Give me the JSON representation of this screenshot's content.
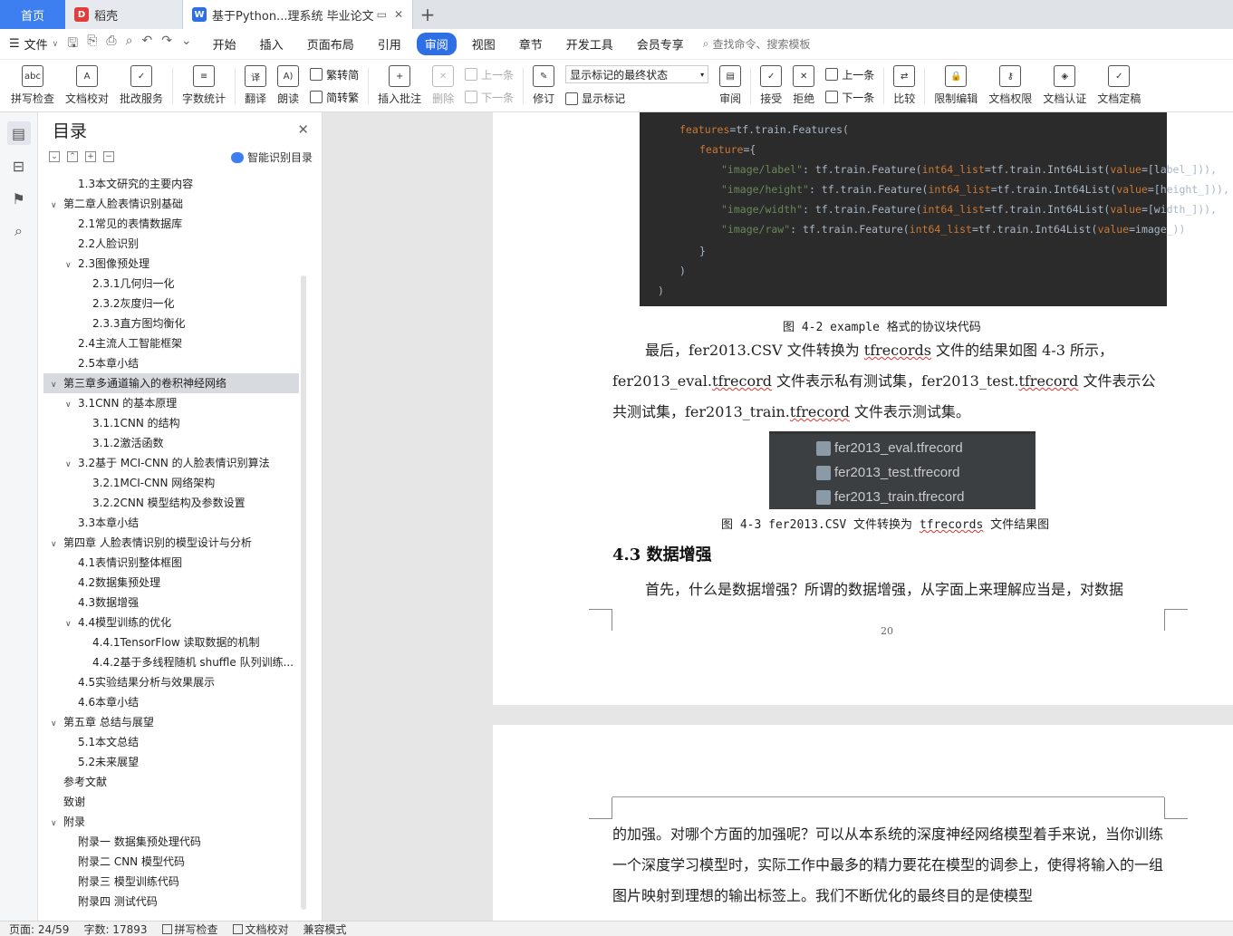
{
  "tabs": {
    "home": "首页",
    "items": [
      {
        "label": "稻壳",
        "state": "inactive",
        "icon": "daoke-logo-icon"
      },
      {
        "label": "基于Python...理系统 毕业论文",
        "state": "active",
        "icon": "wps-writer-logo-icon"
      }
    ]
  },
  "menu": {
    "file": "文件",
    "items": [
      "开始",
      "插入",
      "页面布局",
      "引用",
      "审阅",
      "视图",
      "章节",
      "开发工具",
      "会员专享"
    ],
    "active": "审阅",
    "search_placeholder": "查找命令、搜索模板"
  },
  "ribbon": {
    "spell_check": "拼写检查",
    "doc_proof": "文档校对",
    "annotate_service": "批改服务",
    "word_count": "字数统计",
    "translate": "翻译",
    "read_aloud": "朗读",
    "to_traditional": "繁转简",
    "to_simplified": "简转繁",
    "insert_comment": "插入批注",
    "delete": "删除",
    "prev_comment": "上一条",
    "next_comment": "下一条",
    "track_changes": "修订",
    "markup_state": "显示标记的最终状态",
    "show_markup": "显示标记",
    "review": "审阅",
    "accept": "接受",
    "reject": "拒绝",
    "prev_change": "上一条",
    "next_change": "下一条",
    "compare": "比较",
    "restrict_edit": "限制编辑",
    "doc_permission": "文档权限",
    "doc_certify": "文档认证",
    "doc_finalize": "文档定稿"
  },
  "toc": {
    "title": "目录",
    "smart": "智能识别目录",
    "items": [
      {
        "label": "1.3本文研究的主要内容",
        "level": 2,
        "chev": ""
      },
      {
        "label": "第二章人脸表情识别基础",
        "level": 1,
        "chev": "v"
      },
      {
        "label": "2.1常见的表情数据库",
        "level": 2,
        "chev": ""
      },
      {
        "label": "2.2人脸识别",
        "level": 2,
        "chev": ""
      },
      {
        "label": "2.3图像预处理",
        "level": 2,
        "chev": "v"
      },
      {
        "label": "2.3.1几何归一化",
        "level": 3,
        "chev": ""
      },
      {
        "label": "2.3.2灰度归一化",
        "level": 3,
        "chev": ""
      },
      {
        "label": "2.3.3直方图均衡化",
        "level": 3,
        "chev": ""
      },
      {
        "label": "2.4主流人工智能框架",
        "level": 2,
        "chev": ""
      },
      {
        "label": "2.5本章小结",
        "level": 2,
        "chev": ""
      },
      {
        "label": "第三章多通道输入的卷积神经网络",
        "level": 1,
        "chev": "v",
        "selected": true
      },
      {
        "label": "3.1CNN 的基本原理",
        "level": 2,
        "chev": "v"
      },
      {
        "label": "3.1.1CNN 的结构",
        "level": 3,
        "chev": ""
      },
      {
        "label": "3.1.2激活函数",
        "level": 3,
        "chev": ""
      },
      {
        "label": "3.2基于 MCI-CNN 的人脸表情识别算法",
        "level": 2,
        "chev": "v"
      },
      {
        "label": "3.2.1MCI-CNN 网络架构",
        "level": 3,
        "chev": ""
      },
      {
        "label": "3.2.2CNN 模型结构及参数设置",
        "level": 3,
        "chev": ""
      },
      {
        "label": "3.3本章小结",
        "level": 2,
        "chev": ""
      },
      {
        "label": "第四章 人脸表情识别的模型设计与分析",
        "level": 1,
        "chev": "v"
      },
      {
        "label": "4.1表情识别整体框图",
        "level": 2,
        "chev": ""
      },
      {
        "label": "4.2数据集预处理",
        "level": 2,
        "chev": ""
      },
      {
        "label": "4.3数据增强",
        "level": 2,
        "chev": ""
      },
      {
        "label": "4.4模型训练的优化",
        "level": 2,
        "chev": "v"
      },
      {
        "label": "4.4.1TensorFlow 读取数据的机制",
        "level": 3,
        "chev": ""
      },
      {
        "label": "4.4.2基于多线程随机 shuffle 队列训练...",
        "level": 3,
        "chev": ""
      },
      {
        "label": "4.5实验结果分析与效果展示",
        "level": 2,
        "chev": ""
      },
      {
        "label": "4.6本章小结",
        "level": 2,
        "chev": ""
      },
      {
        "label": "第五章 总结与展望",
        "level": 1,
        "chev": "v"
      },
      {
        "label": "5.1本文总结",
        "level": 2,
        "chev": ""
      },
      {
        "label": "5.2未来展望",
        "level": 2,
        "chev": ""
      },
      {
        "label": "参考文献",
        "level": 1,
        "chev": ""
      },
      {
        "label": "致谢",
        "level": 1,
        "chev": ""
      },
      {
        "label": "附录",
        "level": 1,
        "chev": "v"
      },
      {
        "label": "附录一 数据集预处理代码",
        "level": 2,
        "chev": ""
      },
      {
        "label": "附录二 CNN 模型代码",
        "level": 2,
        "chev": ""
      },
      {
        "label": "附录三 模型训练代码",
        "level": 2,
        "chev": ""
      },
      {
        "label": "附录四 测试代码",
        "level": 2,
        "chev": ""
      }
    ]
  },
  "doc": {
    "code": {
      "line1_var": "features",
      "line1_rest": "=tf.train.Features(",
      "line2_var": "feature",
      "line2_rest": "={",
      "entries": [
        {
          "key": "\"image/label\"",
          "mid": ": tf.train.Feature(",
          "kw": "int64_list",
          "mid2": "=tf.train.Int64List(",
          "kw2": "value",
          "end": "=[label_])),"
        },
        {
          "key": "\"image/height\"",
          "mid": ": tf.train.Feature(",
          "kw": "int64_list",
          "mid2": "=tf.train.Int64List(",
          "kw2": "value",
          "end": "=[height_])),"
        },
        {
          "key": "\"image/width\"",
          "mid": ": tf.train.Feature(",
          "kw": "int64_list",
          "mid2": "=tf.train.Int64List(",
          "kw2": "value",
          "end": "=[width_])),"
        },
        {
          "key": "\"image/raw\"",
          "mid": ": tf.train.Feature(",
          "kw": "int64_list",
          "mid2": "=tf.train.Int64List(",
          "kw2": "value",
          "end": "=image_))"
        }
      ],
      "close1": "}",
      "close2": ")",
      "close3": ")"
    },
    "caption_42": "图 4-2 example 格式的协议块代码",
    "para1": {
      "t1": "最后，fer2013.CSV 文件转换为 ",
      "sq1": "tfrecords",
      "t2": " 文件的结果如图 4-3 所示，fer2013_eval.",
      "sq2": "tfrecord",
      "t3": " 文件表示私有测试集，fer2013_test.",
      "sq3": "tfrecord",
      "t4": " 文件表示公共测试集，fer2013_train.",
      "sq4": "tfrecord",
      "t5": " 文件表示测试集。"
    },
    "files": [
      "fer2013_eval.tfrecord",
      "fer2013_test.tfrecord",
      "fer2013_train.tfrecord"
    ],
    "caption_43_a": "图 4-3 fer2013.CSV 文件转换为 ",
    "caption_43_sq": "tfrecords",
    "caption_43_b": " 文件结果图",
    "heading": "4.3 数据增强",
    "para2": "首先，什么是数据增强？所谓的数据增强，从字面上来理解应当是，对数据",
    "page_number": "20",
    "para3": "的加强。对哪个方面的加强呢？可以从本系统的深度神经网络模型着手来说，当你训练一个深度学习模型时，实际工作中最多的精力要花在模型的调参上，使得将输入的一组图片映射到理想的输出标签上。我们不断优化的最终目的是使模型"
  },
  "status": {
    "page": "页面: 24/59",
    "words": "字数: 17893",
    "spell": "拼写检查",
    "proof": "文档校对",
    "compat": "兼容模式"
  }
}
